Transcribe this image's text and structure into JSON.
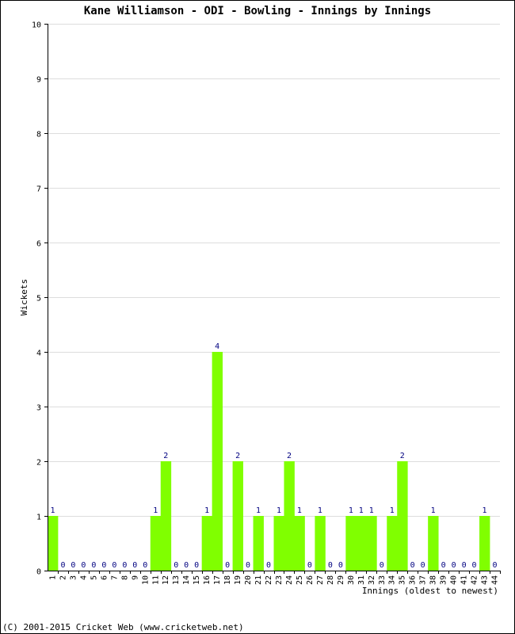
{
  "chart_data": {
    "type": "bar",
    "title": "Kane Williamson - ODI - Bowling - Innings by Innings",
    "xlabel": "Innings (oldest to newest)",
    "ylabel": "Wickets",
    "ylim": [
      0,
      10
    ],
    "yticks": [
      0,
      1,
      2,
      3,
      4,
      5,
      6,
      7,
      8,
      9,
      10
    ],
    "grid": true,
    "bar_color": "#80ff00",
    "label_color": "#000080",
    "categories": [
      "1",
      "2",
      "3",
      "4",
      "5",
      "6",
      "7",
      "8",
      "9",
      "10",
      "11",
      "12",
      "13",
      "14",
      "15",
      "16",
      "17",
      "18",
      "19",
      "20",
      "21",
      "22",
      "23",
      "24",
      "25",
      "26",
      "27",
      "28",
      "29",
      "30",
      "31",
      "32",
      "33",
      "34",
      "35",
      "36",
      "37",
      "38",
      "39",
      "40",
      "41",
      "42",
      "43",
      "44"
    ],
    "values": [
      1,
      0,
      0,
      0,
      0,
      0,
      0,
      0,
      0,
      0,
      1,
      2,
      0,
      0,
      0,
      1,
      4,
      0,
      2,
      0,
      1,
      0,
      1,
      2,
      1,
      0,
      1,
      0,
      0,
      1,
      1,
      1,
      0,
      1,
      2,
      0,
      0,
      1,
      0,
      0,
      0,
      0,
      1,
      0
    ]
  },
  "footer": {
    "copyright": "(C) 2001-2015 Cricket Web (www.cricketweb.net)"
  }
}
